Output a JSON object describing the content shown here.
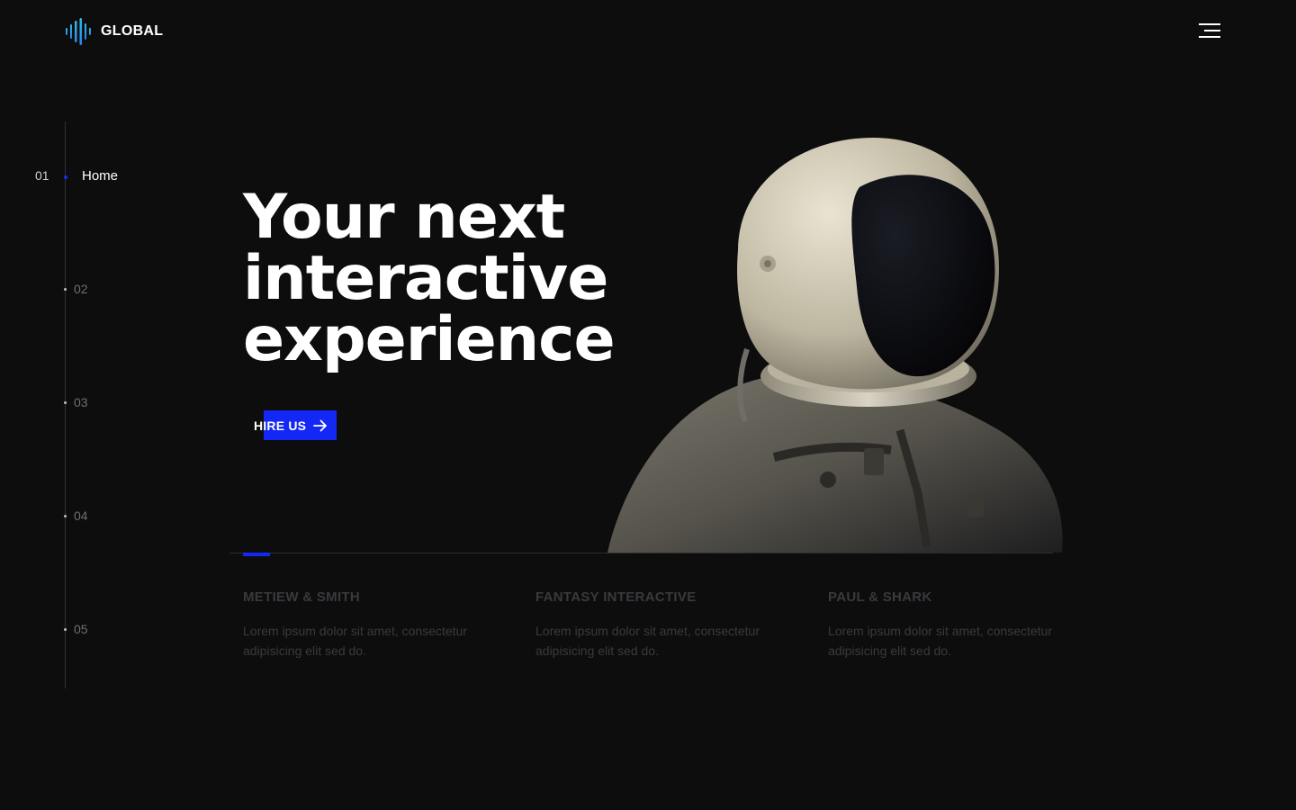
{
  "header": {
    "brand": "GLOBAL",
    "logo_icon": "sound-wave-icon",
    "menu_icon": "hamburger-menu-icon"
  },
  "side_nav": {
    "active": {
      "number": "01",
      "label": "Home"
    },
    "items": [
      {
        "number": "02"
      },
      {
        "number": "03"
      },
      {
        "number": "04"
      },
      {
        "number": "05"
      }
    ]
  },
  "hero": {
    "title_lines": [
      "Your next",
      "interactive",
      "experience"
    ],
    "cta_label": "HIRE US",
    "cta_icon": "arrow-right-icon"
  },
  "slider": {
    "progress": 0.033
  },
  "projects": [
    {
      "title": "METIEW & SMITH",
      "description": "Lorem ipsum dolor sit amet, consectetur adipisicing elit sed do."
    },
    {
      "title": "FANTASY INTERACTIVE",
      "description": "Lorem ipsum dolor sit amet, consectetur adipisicing elit sed do."
    },
    {
      "title": "PAUL & SHARK",
      "description": "Lorem ipsum dolor sit amet, consectetur adipisicing elit sed do."
    }
  ],
  "colors": {
    "background": "#0d0d0e",
    "accent": "#1428f5",
    "logo_gradient_start": "#2fd3d8",
    "logo_gradient_end": "#2a6cf0"
  }
}
